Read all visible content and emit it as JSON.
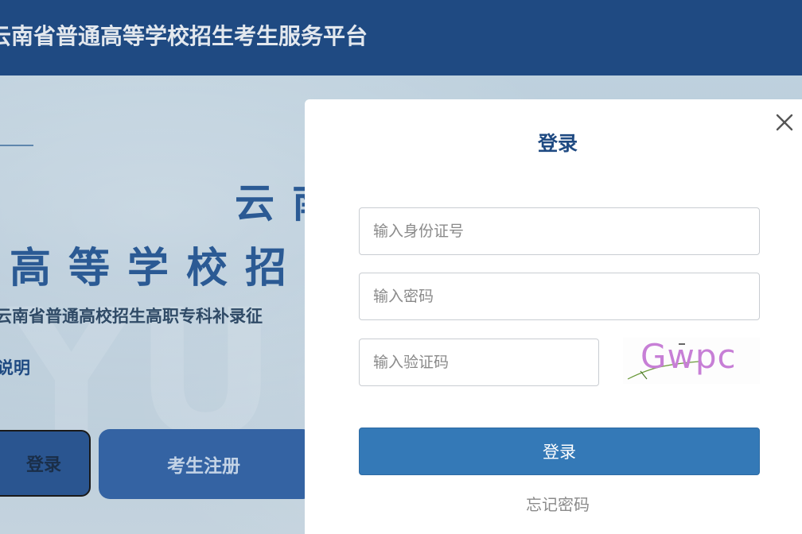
{
  "header": {
    "title": "云南省普通高等学校招生考生服务平台"
  },
  "hero": {
    "line1": "云南",
    "line2": "高等学校招",
    "subtitle": "云南省普通高校招生高职专科补录征",
    "link": "说明",
    "watermark": "YU"
  },
  "actions": {
    "login_label": "登录",
    "register_label": "考生注册"
  },
  "modal": {
    "title": "登录",
    "id_placeholder": "输入身份证号",
    "password_placeholder": "输入密码",
    "captcha_placeholder": "输入验证码",
    "captcha_text": "Gwpc",
    "submit_label": "登录",
    "forgot_label": "忘记密码"
  },
  "colors": {
    "header_bg": "#1f4a82",
    "accent": "#3479b7",
    "title_blue": "#1f4a82",
    "captcha_text": "#c77fd6"
  },
  "icons": {
    "close": "close-icon"
  }
}
